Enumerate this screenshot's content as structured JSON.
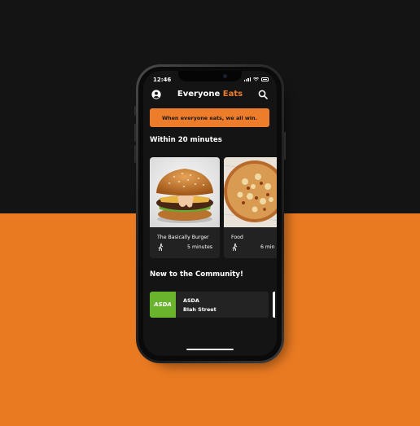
{
  "status_bar": {
    "time": "12:46"
  },
  "header": {
    "title_main": "Everyone",
    "title_accent": "Eats"
  },
  "banner": {
    "text": "When everyone eats, we all win."
  },
  "sections": {
    "nearby_title": "Within 20 minutes",
    "new_title": "New to the Community!"
  },
  "cards": [
    {
      "name": "The Basically Burger",
      "time": "5 minutes"
    },
    {
      "name": "Food",
      "time": "6 min"
    }
  ],
  "stores": [
    {
      "logo": "ASDA",
      "name": "ASDA",
      "address": "Blah Street"
    }
  ],
  "colors": {
    "accent": "#ee7d2b",
    "background_top": "#141414",
    "background_bottom": "#e97a22",
    "store_logo": "#6ab42d"
  },
  "icons": [
    "profile-icon",
    "search-icon",
    "walk-icon",
    "signal-icon",
    "wifi-icon",
    "battery-icon"
  ]
}
